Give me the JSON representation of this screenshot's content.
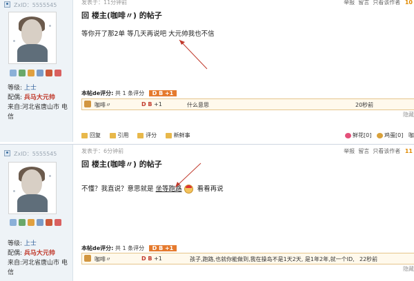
{
  "posts": [
    {
      "zid": "ZxID：5555545",
      "meta": "发表于：11分钟前",
      "tools": [
        "举报",
        "留言",
        "只看该作者"
      ],
      "floor": "10",
      "title": "回 楼主(咖啡〃) 的帖子",
      "content_a": "等你开了那2单  等几天再说吧    ",
      "content_b": "大元帅我也不信",
      "rank_label": "等级:",
      "rank_value": "上士",
      "medal_label": "配偶:",
      "medal_value": "兵马大元帅",
      "from": "来自:河北省唐山市 电信",
      "rate_head": "本帖de评分:",
      "rate_count": "共 1 条评分",
      "rate_badge": "D B +1",
      "rate_user": "咖啡〃",
      "rate_db": "D B",
      "rate_plus": "+1",
      "rate_reason": "什么意思",
      "rate_time": "20秒前",
      "hide": "隐藏",
      "actions": [
        "回复",
        "引用",
        "评分",
        "新鲜事"
      ],
      "flower": "鲜花[0]",
      "egg": "鸡蛋[0]",
      "more": "咖"
    },
    {
      "zid": "ZxID：5555545",
      "meta": "发表于：6分钟前",
      "tools": [
        "举报",
        "留言",
        "只看该作者"
      ],
      "floor": "11",
      "title": "回 楼主(咖啡〃) 的帖子",
      "content_a": "不懂？我直说？意思就是 ",
      "content_u": "坐等跑路",
      "content_b": "  看看再说",
      "rank_label": "等级:",
      "rank_value": "上士",
      "medal_label": "配偶:",
      "medal_value": "兵马大元帅",
      "from": "来自:河北省唐山市 电信",
      "rate_head": "本帖de评分:",
      "rate_count": "共 1 条评分",
      "rate_badge": "D B +1",
      "rate_user": "咖啡〃",
      "rate_db": "D B",
      "rate_plus": "+1",
      "rate_reason": "孩子,跑路,也就你能做到,我在操岛不是1天2天, 是1年2年,就一个ID,",
      "rate_time": "22秒前",
      "hide": "隐藏"
    }
  ],
  "colors": {
    "accent": "#e57a2e",
    "link": "#2d5d99",
    "arrow": "#c0392b"
  }
}
